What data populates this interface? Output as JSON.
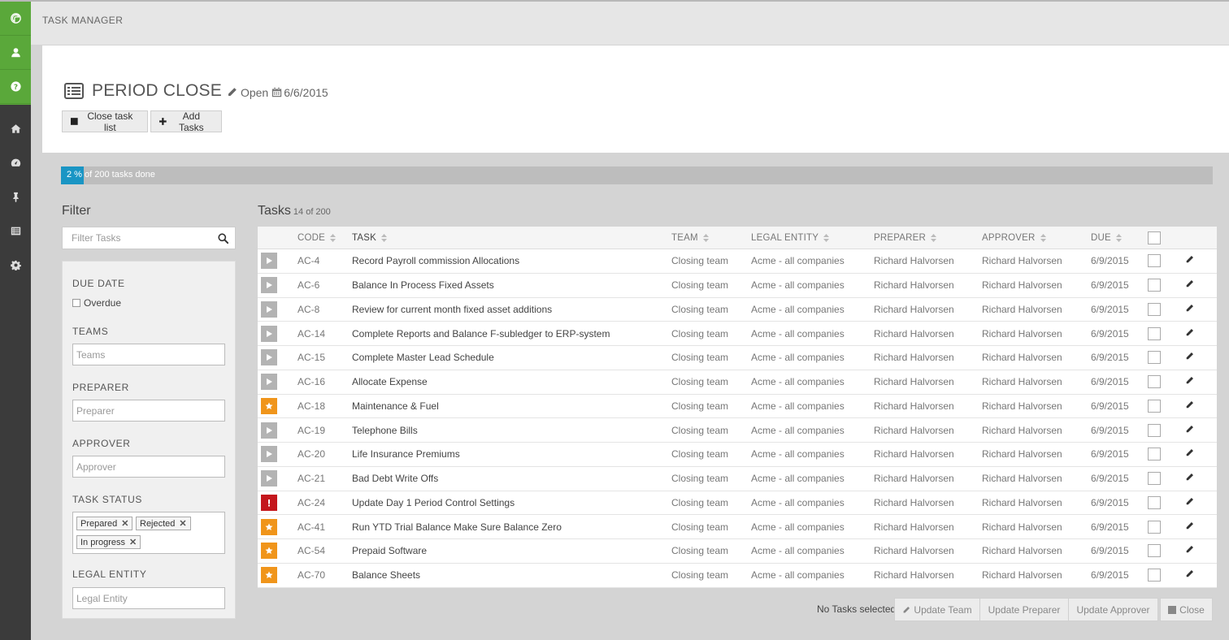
{
  "app": {
    "title": "TASK MANAGER"
  },
  "rail": {
    "icons": [
      "leaf-icon",
      "user-icon",
      "help-icon",
      "home-icon",
      "dashboard-icon",
      "pin-icon",
      "list-icon",
      "gear-icon"
    ]
  },
  "header": {
    "title": "PERIOD CLOSE",
    "status": "Open",
    "date": "6/6/2015",
    "close_task_list": "Close task list",
    "add_tasks": "Add Tasks"
  },
  "progress": {
    "percent": 2,
    "label": "2 % of 200 tasks done"
  },
  "filter": {
    "title": "Filter",
    "search_placeholder": "Filter Tasks",
    "due_date_label": "DUE DATE",
    "overdue_label": "Overdue",
    "teams_label": "TEAMS",
    "teams_placeholder": "Teams",
    "preparer_label": "PREPARER",
    "preparer_placeholder": "Preparer",
    "approver_label": "APPROVER",
    "approver_placeholder": "Approver",
    "task_status_label": "TASK STATUS",
    "status_tags": [
      "Prepared",
      "Rejected",
      "In progress"
    ],
    "legal_entity_label": "LEGAL ENTITY",
    "legal_entity_placeholder": "Legal Entity"
  },
  "tasks": {
    "title": "Tasks",
    "count": "14 of 200",
    "columns": {
      "code": "CODE",
      "task": "TASK",
      "team": "TEAM",
      "entity": "LEGAL ENTITY",
      "preparer": "PREPARER",
      "approver": "APPROVER",
      "due": "DUE"
    },
    "rows": [
      {
        "status": "play",
        "code": "AC-4",
        "task": "Record Payroll commission Allocations",
        "team": "Closing team",
        "entity": "Acme - all companies",
        "preparer": "Richard Halvorsen",
        "approver": "Richard Halvorsen",
        "due": "6/9/2015"
      },
      {
        "status": "play",
        "code": "AC-6",
        "task": "Balance In Process Fixed Assets",
        "team": "Closing team",
        "entity": "Acme - all companies",
        "preparer": "Richard Halvorsen",
        "approver": "Richard Halvorsen",
        "due": "6/9/2015"
      },
      {
        "status": "play",
        "code": "AC-8",
        "task": "Review for current month fixed asset additions",
        "team": "Closing team",
        "entity": "Acme - all companies",
        "preparer": "Richard Halvorsen",
        "approver": "Richard Halvorsen",
        "due": "6/9/2015"
      },
      {
        "status": "play",
        "code": "AC-14",
        "task": "Complete Reports and Balance F-subledger to ERP-system",
        "team": "Closing team",
        "entity": "Acme - all companies",
        "preparer": "Richard Halvorsen",
        "approver": "Richard Halvorsen",
        "due": "6/9/2015"
      },
      {
        "status": "play",
        "code": "AC-15",
        "task": "Complete Master Lead Schedule",
        "team": "Closing team",
        "entity": "Acme - all companies",
        "preparer": "Richard Halvorsen",
        "approver": "Richard Halvorsen",
        "due": "6/9/2015"
      },
      {
        "status": "play",
        "code": "AC-16",
        "task": "Allocate Expense",
        "team": "Closing team",
        "entity": "Acme - all companies",
        "preparer": "Richard Halvorsen",
        "approver": "Richard Halvorsen",
        "due": "6/9/2015"
      },
      {
        "status": "star",
        "code": "AC-18",
        "task": "Maintenance & Fuel",
        "team": "Closing team",
        "entity": "Acme - all companies",
        "preparer": "Richard Halvorsen",
        "approver": "Richard Halvorsen",
        "due": "6/9/2015"
      },
      {
        "status": "play",
        "code": "AC-19",
        "task": "Telephone Bills",
        "team": "Closing team",
        "entity": "Acme - all companies",
        "preparer": "Richard Halvorsen",
        "approver": "Richard Halvorsen",
        "due": "6/9/2015"
      },
      {
        "status": "play",
        "code": "AC-20",
        "task": "Life Insurance Premiums",
        "team": "Closing team",
        "entity": "Acme - all companies",
        "preparer": "Richard Halvorsen",
        "approver": "Richard Halvorsen",
        "due": "6/9/2015"
      },
      {
        "status": "play",
        "code": "AC-21",
        "task": "Bad Debt Write Offs",
        "team": "Closing team",
        "entity": "Acme - all companies",
        "preparer": "Richard Halvorsen",
        "approver": "Richard Halvorsen",
        "due": "6/9/2015"
      },
      {
        "status": "alert",
        "code": "AC-24",
        "task": "Update Day 1 Period Control Settings",
        "team": "Closing team",
        "entity": "Acme - all companies",
        "preparer": "Richard Halvorsen",
        "approver": "Richard Halvorsen",
        "due": "6/9/2015"
      },
      {
        "status": "star",
        "code": "AC-41",
        "task": "Run YTD Trial Balance Make Sure Balance Zero",
        "team": "Closing team",
        "entity": "Acme - all companies",
        "preparer": "Richard Halvorsen",
        "approver": "Richard Halvorsen",
        "due": "6/9/2015"
      },
      {
        "status": "star",
        "code": "AC-54",
        "task": "Prepaid Software",
        "team": "Closing team",
        "entity": "Acme - all companies",
        "preparer": "Richard Halvorsen",
        "approver": "Richard Halvorsen",
        "due": "6/9/2015"
      },
      {
        "status": "star",
        "code": "AC-70",
        "task": "Balance Sheets",
        "team": "Closing team",
        "entity": "Acme - all companies",
        "preparer": "Richard Halvorsen",
        "approver": "Richard Halvorsen",
        "due": "6/9/2015"
      }
    ]
  },
  "footer": {
    "selection": "No Tasks selected",
    "update_team": "Update Team",
    "update_preparer": "Update Preparer",
    "update_approver": "Update Approver",
    "close": "Close"
  },
  "colors": {
    "green": "#5aa83a",
    "accent": "#1a95c4",
    "star": "#f0951b",
    "alert": "#c4161c"
  }
}
